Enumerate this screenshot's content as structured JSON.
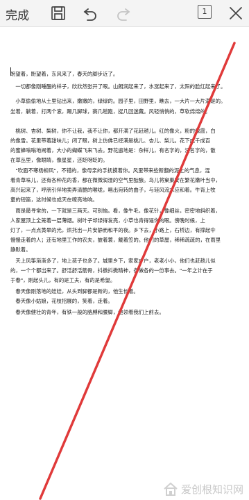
{
  "toolbar": {
    "done_label": "完成",
    "page_count": "1",
    "icons": [
      "save-icon",
      "undo-icon",
      "redo-icon",
      "page-count-icon",
      "close-icon"
    ]
  },
  "document": {
    "paragraphs": [
      "盼望着，盼望着，东风来了，春天的脚步近了。",
      "　一切都像刚睡醒的样子，欣欣然张开了眼。山朗润起来了，水涨起来了，太阳的脸红起来了。",
      "　小草偷偷地从土里钻出来，嫩嫩的，绿绿的。园子里，田野里，瞧去，一大片一大片满是的。",
      "坐着，躺着，打两个滚，踢几脚球，赛几趟跑，捉几回迷藏。风轻悄悄的，草软绵绵的。",
      "　桃树、杏树、梨树，你不让我，我不让你，都开满了花赶趟儿。红的像火，粉的像霞，白",
      "的像雪。花里带着甜味儿；闭了眼，树上仿佛已经满是桃儿、杏儿、梨儿。花下成千成百",
      "的蜜蜂嗡嗡地闹着，大小的蝴蝶飞来飞去。野花遍地是：杂样儿，有名字的，没名字的，散",
      "在草丛里，像眼睛，像星星，还眨呀眨的。",
      "　\"吹面不寒杨柳风\"，不错的，像母亲的手抚摸着你。风里带来些新翻的泥土的气息，混",
      "着青草味儿，还有各种花的香，都在微微润湿的空气里酝酿。鸟儿将窠巢安在繁花嫩叶当中，",
      "高兴起来了，呼朋引伴地卖弄清脆的喉咙，唱出宛转的曲子，与轻风流水应和着。牛背上牧",
      "童的短笛，这时候也成天在嘹亮地响。",
      "　雨是最寻常的，一下就是三两天。可别恼。看，像牛毛，像花针，像细丝，密密地斜织着，",
      "人家屋顶上全笼着一层薄烟。树叶子却绿得发亮，小草也青得逼你的眼。傍晚时候，上",
      "灯了，一点点黄晕的光，烘托出一片安静而和平的夜。乡下去，小路上，石桥边，有撑起伞",
      "慢慢走着的人；还有地里工作的农夫，披着蓑，戴着笠的。他们的草屋，稀稀疏疏的，在雨里",
      "静默着。",
      "　天上风筝渐渐多了，地上孩子也多了。城里乡下，家家户户，老老小小，他们也赶趟儿似",
      "的，一个个都出来了。舒活舒活筋骨，抖擞抖擞精神，各做各的一份事去。\"一年之计在于",
      "于春\"，刚起头儿，有的是工夫，有的是希望。",
      "　春天像刚落地的娃娃，从头到脚都是新的，他生长着。",
      "　春天像小姑娘，花枝招展的，笑着，走着。",
      "　春天像健壮的青年，有铁一般的胳膊和腰脚，他领着我们上前去。"
    ]
  },
  "colors": {
    "toolbar_bg": "#f4f4f4",
    "annotation_line": "#e03a3a",
    "text": "#222222"
  },
  "watermark": {
    "text": "爱创根知识网",
    "logo_icon": "house-logo-icon"
  }
}
